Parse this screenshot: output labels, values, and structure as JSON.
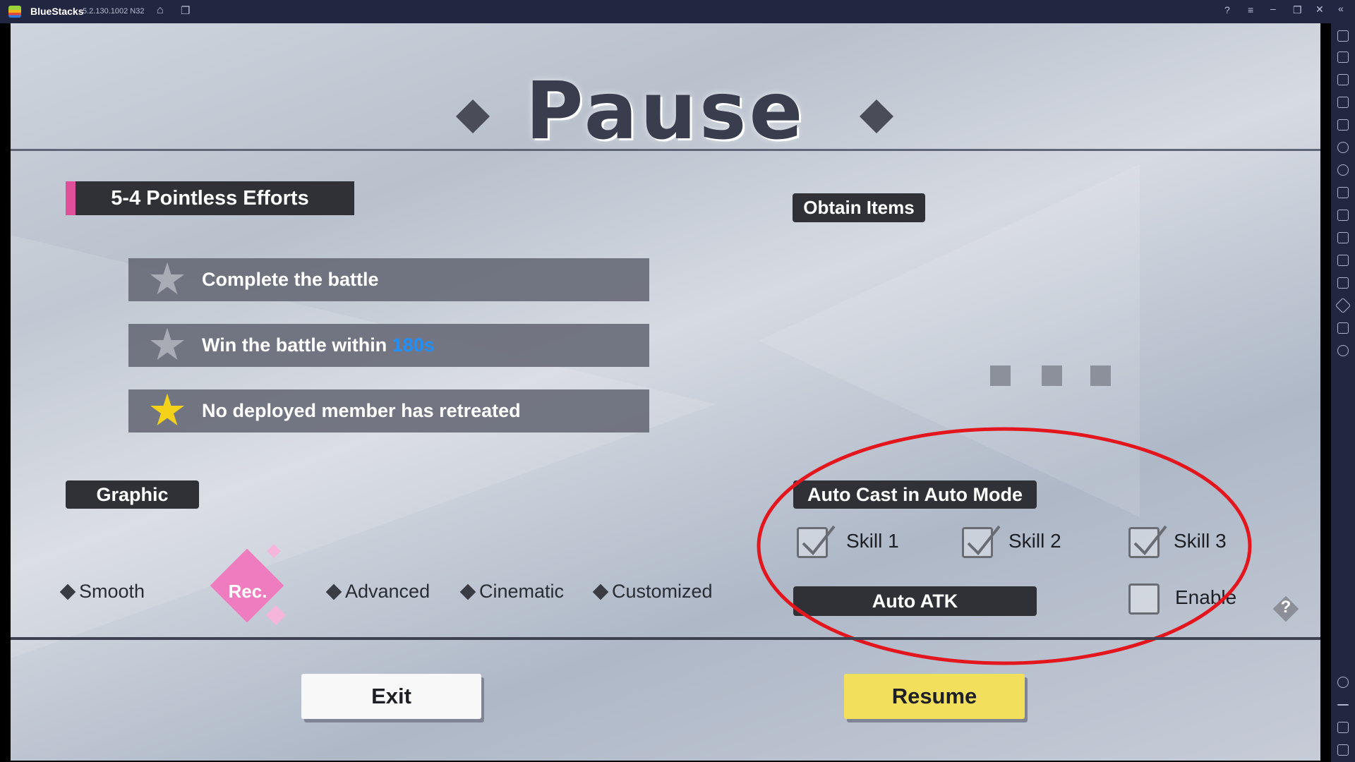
{
  "window": {
    "app_name": "BlueStacks",
    "version": "5.2.130.1002 N32"
  },
  "game": {
    "title": "Pause",
    "stage_title": "5-4 Pointless Efforts",
    "obtain_items_label": "Obtain Items",
    "objectives": [
      {
        "prefix": "Complete the battle",
        "highlight": "",
        "achieved": false
      },
      {
        "prefix": "Win the battle within ",
        "highlight": "180s",
        "achieved": false
      },
      {
        "prefix": "No deployed member has retreated",
        "highlight": "",
        "achieved": true
      }
    ],
    "graphic_label": "Graphic",
    "graphic_options": [
      "Smooth",
      "Rec.",
      "Advanced",
      "Cinematic",
      "Customized"
    ],
    "graphic_selected": "Rec.",
    "auto_cast_label": "Auto Cast in Auto Mode",
    "skills": [
      {
        "label": "Skill 1",
        "checked": true
      },
      {
        "label": "Skill 2",
        "checked": true
      },
      {
        "label": "Skill 3",
        "checked": true
      }
    ],
    "auto_atk_label": "Auto ATK",
    "enable_label": "Enable",
    "enable_checked": false,
    "help_label": "?",
    "exit_label": "Exit",
    "resume_label": "Resume"
  },
  "colors": {
    "highlight": "#1e90ff",
    "accent_pink": "#e0509a",
    "resume_yellow": "#f2df5c",
    "annotation_red": "#e3161e"
  },
  "sidebar_icons": [
    "collapse-icon",
    "fullscreen-icon",
    "volume-up-icon",
    "volume-down-icon",
    "pointer-icon",
    "keyboard-icon",
    "macro-icon",
    "rotate-icon",
    "shake-icon",
    "apk-install-icon",
    "screenshot-icon",
    "folder-icon",
    "multi-instance-icon",
    "eco-mode-icon",
    "layers-icon",
    "performance-icon",
    "settings-icon",
    "back-icon",
    "home-icon",
    "recent-apps-icon"
  ]
}
